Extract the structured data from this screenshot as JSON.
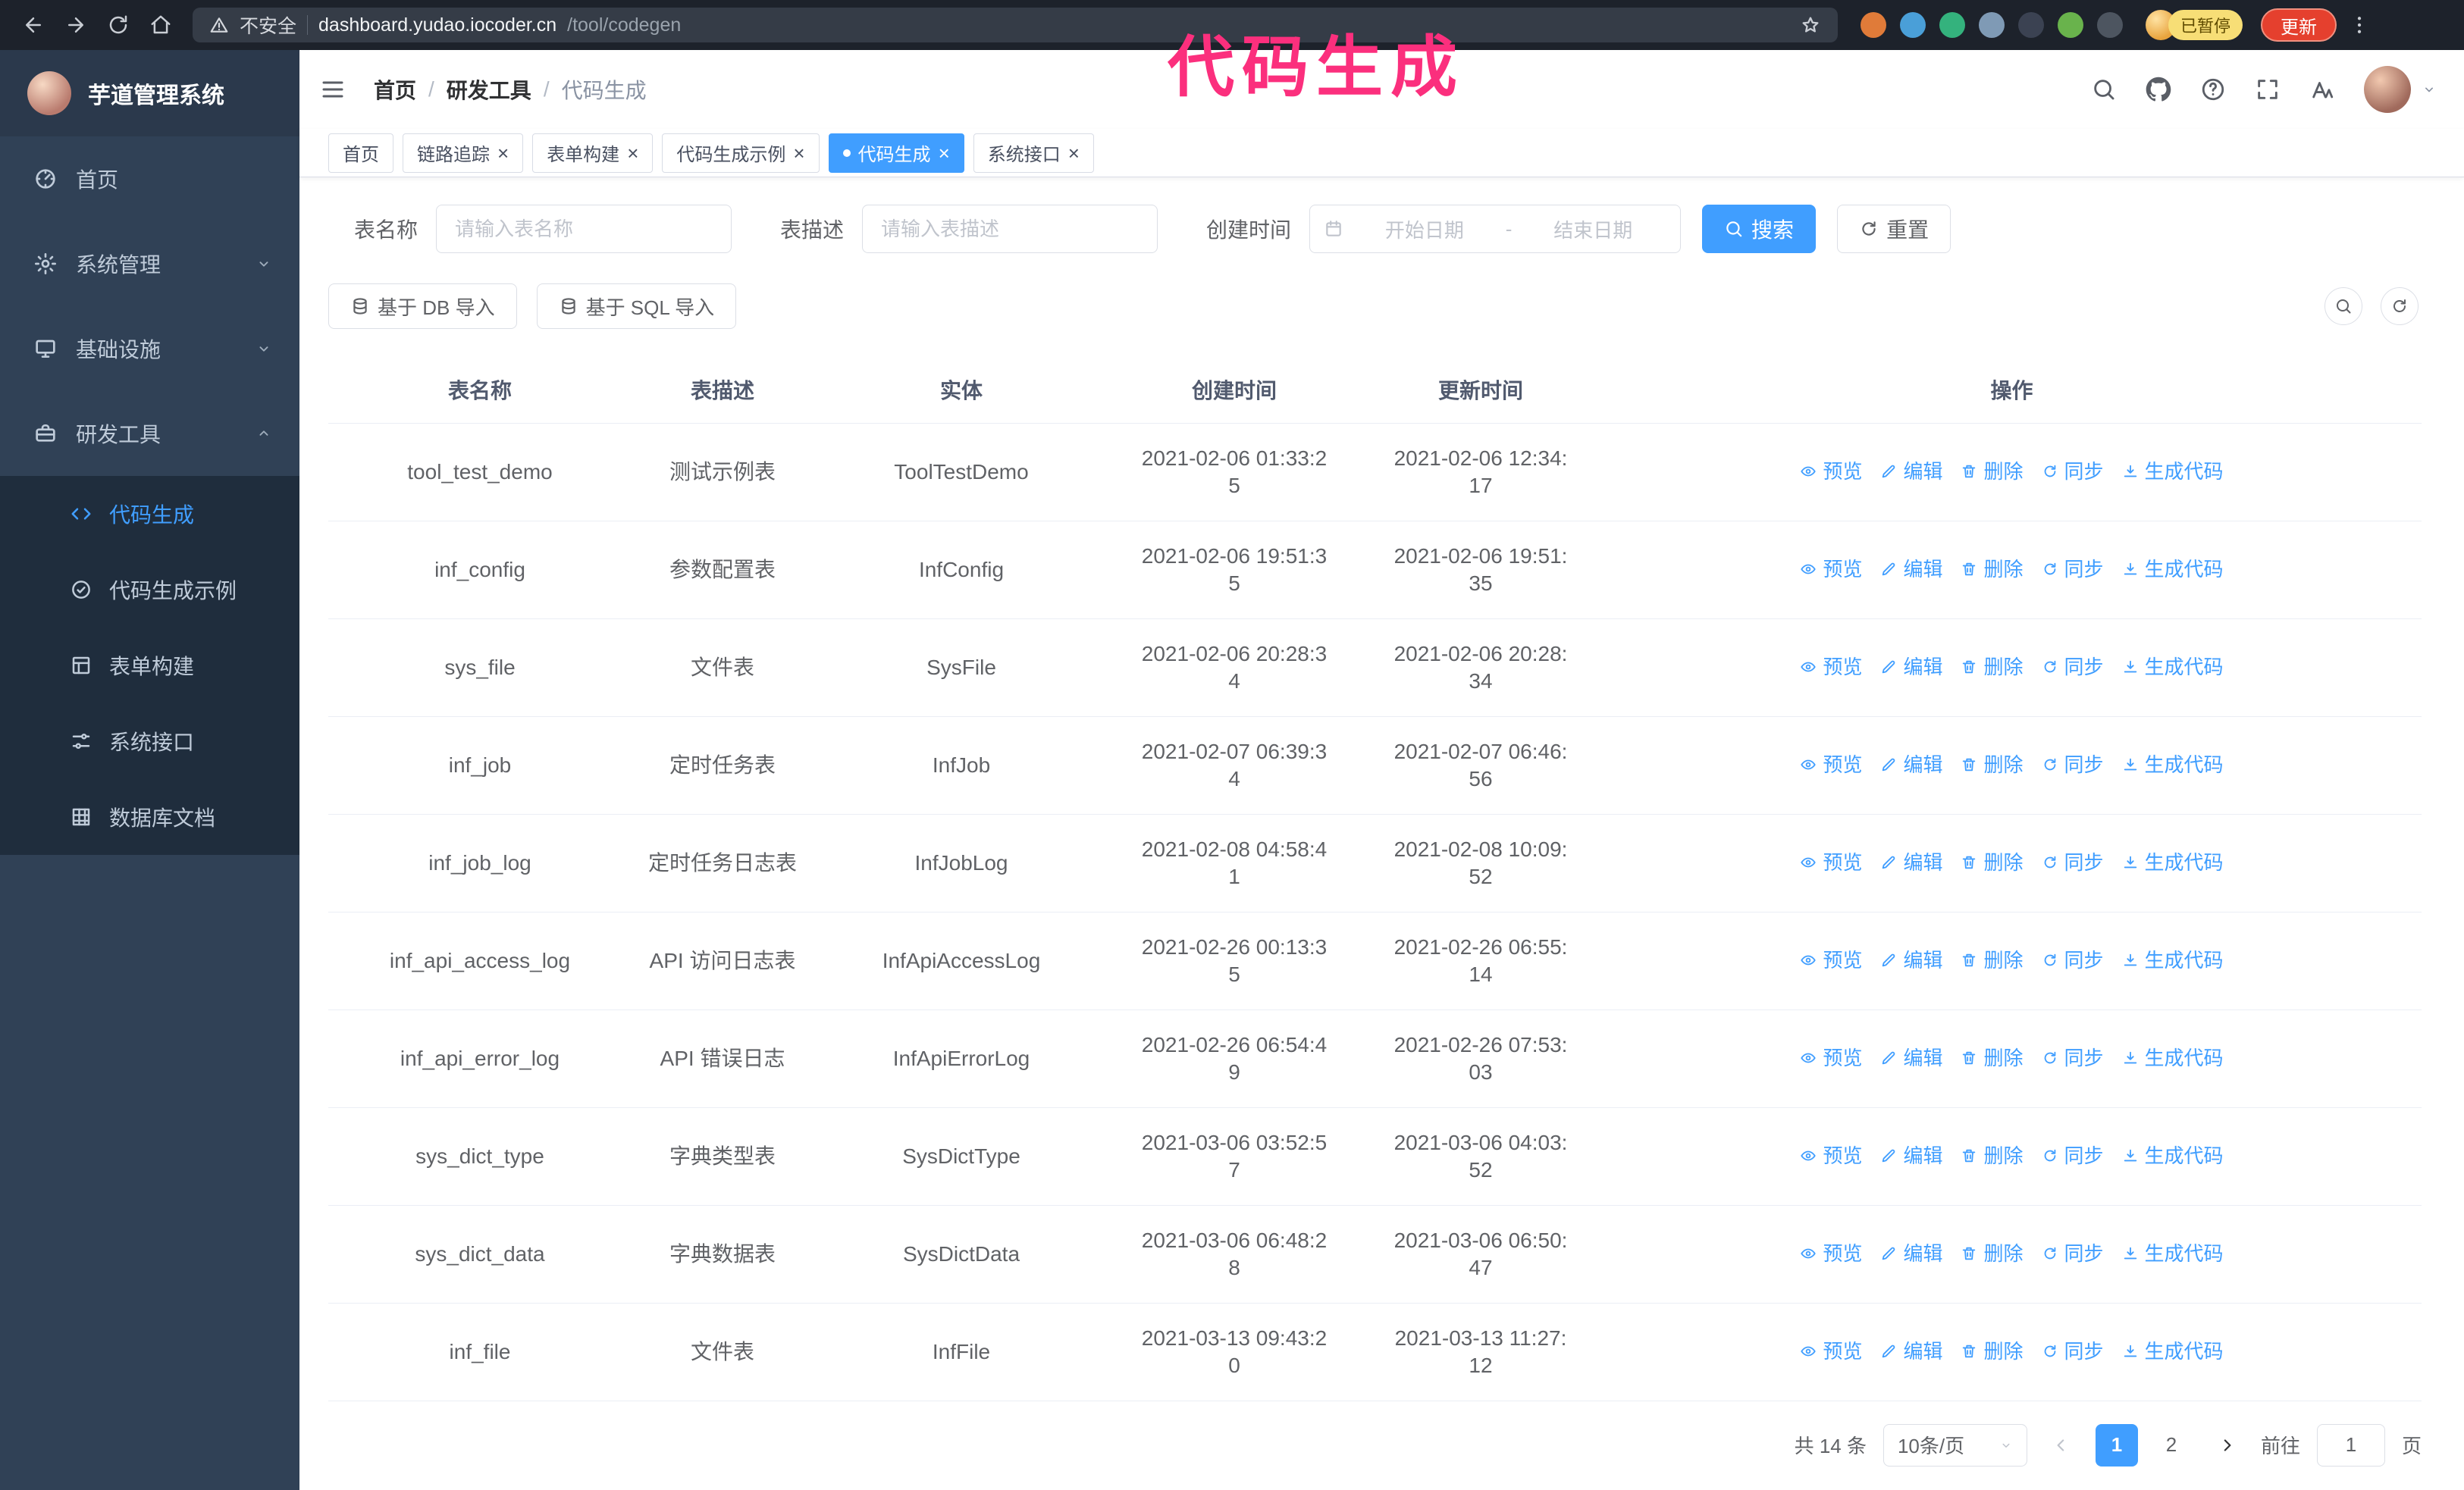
{
  "annotation": {
    "text": "代码生成"
  },
  "browser": {
    "security_label": "不安全",
    "url_host": "dashboard.yudao.iocoder.cn",
    "url_path": "/tool/codegen",
    "paused_badge": "已暂停",
    "update_button": "更新",
    "extension_colors": [
      "#e07b39",
      "#4a9fd8",
      "#34b27d",
      "#7f9ab5",
      "#3b4252",
      "#69b34c",
      "#4d5560"
    ]
  },
  "sidebar": {
    "app_title": "芋道管理系统",
    "items": [
      {
        "label": "首页",
        "icon": "dashboard-icon",
        "chevron": null,
        "expanded": false
      },
      {
        "label": "系统管理",
        "icon": "gear-icon",
        "chevron": "down",
        "expanded": false
      },
      {
        "label": "基础设施",
        "icon": "monitor-icon",
        "chevron": "down",
        "expanded": false
      },
      {
        "label": "研发工具",
        "icon": "briefcase-icon",
        "chevron": "up",
        "expanded": true
      }
    ],
    "subitems": [
      {
        "label": "代码生成",
        "icon": "code-icon",
        "active": true
      },
      {
        "label": "代码生成示例",
        "icon": "badge-icon",
        "active": false
      },
      {
        "label": "表单构建",
        "icon": "form-icon",
        "active": false
      },
      {
        "label": "系统接口",
        "icon": "sliders-icon",
        "active": false
      },
      {
        "label": "数据库文档",
        "icon": "grid-icon",
        "active": false
      }
    ]
  },
  "header": {
    "breadcrumb": [
      "首页",
      "研发工具",
      "代码生成"
    ],
    "separator": "/"
  },
  "tabs": [
    {
      "label": "首页",
      "closable": false,
      "active": false
    },
    {
      "label": "链路追踪",
      "closable": true,
      "active": false
    },
    {
      "label": "表单构建",
      "closable": true,
      "active": false
    },
    {
      "label": "代码生成示例",
      "closable": true,
      "active": false
    },
    {
      "label": "代码生成",
      "closable": true,
      "active": true
    },
    {
      "label": "系统接口",
      "closable": true,
      "active": false
    }
  ],
  "filters": {
    "table_name_label": "表名称",
    "table_name_placeholder": "请输入表名称",
    "table_desc_label": "表描述",
    "table_desc_placeholder": "请输入表描述",
    "create_time_label": "创建时间",
    "start_date_placeholder": "开始日期",
    "range_separator": "-",
    "end_date_placeholder": "结束日期",
    "search_button": "搜索",
    "reset_button": "重置"
  },
  "toolbar": {
    "import_db_label": "基于 DB 导入",
    "import_sql_label": "基于 SQL 导入"
  },
  "table": {
    "columns": [
      "表名称",
      "表描述",
      "实体",
      "创建时间",
      "更新时间",
      "操作"
    ],
    "action_labels": [
      "预览",
      "编辑",
      "删除",
      "同步",
      "生成代码"
    ],
    "action_icons": [
      "eye-icon",
      "edit-icon",
      "delete-icon",
      "sync-icon",
      "download-icon"
    ],
    "rows": [
      {
        "name": "tool_test_demo",
        "desc": "测试示例表",
        "entity": "ToolTestDemo",
        "created": "2021-02-06 01:33:25",
        "updated": "2021-02-06 12:34:17"
      },
      {
        "name": "inf_config",
        "desc": "参数配置表",
        "entity": "InfConfig",
        "created": "2021-02-06 19:51:35",
        "updated": "2021-02-06 19:51:35"
      },
      {
        "name": "sys_file",
        "desc": "文件表",
        "entity": "SysFile",
        "created": "2021-02-06 20:28:34",
        "updated": "2021-02-06 20:28:34"
      },
      {
        "name": "inf_job",
        "desc": "定时任务表",
        "entity": "InfJob",
        "created": "2021-02-07 06:39:34",
        "updated": "2021-02-07 06:46:56"
      },
      {
        "name": "inf_job_log",
        "desc": "定时任务日志表",
        "entity": "InfJobLog",
        "created": "2021-02-08 04:58:41",
        "updated": "2021-02-08 10:09:52"
      },
      {
        "name": "inf_api_access_log",
        "desc": "API 访问日志表",
        "entity": "InfApiAccessLog",
        "created": "2021-02-26 00:13:35",
        "updated": "2021-02-26 06:55:14"
      },
      {
        "name": "inf_api_error_log",
        "desc": "API 错误日志",
        "entity": "InfApiErrorLog",
        "created": "2021-02-26 06:54:49",
        "updated": "2021-02-26 07:53:03"
      },
      {
        "name": "sys_dict_type",
        "desc": "字典类型表",
        "entity": "SysDictType",
        "created": "2021-03-06 03:52:57",
        "updated": "2021-03-06 04:03:52"
      },
      {
        "name": "sys_dict_data",
        "desc": "字典数据表",
        "entity": "SysDictData",
        "created": "2021-03-06 06:48:28",
        "updated": "2021-03-06 06:50:47"
      },
      {
        "name": "inf_file",
        "desc": "文件表",
        "entity": "InfFile",
        "created": "2021-03-13 09:43:20",
        "updated": "2021-03-13 11:27:12"
      }
    ]
  },
  "pagination": {
    "total_label": "共 14 条",
    "page_size_label": "10条/页",
    "pages": [
      "1",
      "2"
    ],
    "active_page": "1",
    "goto_label": "前往",
    "goto_value": "1",
    "goto_unit": "页"
  },
  "colors": {
    "accent": "#409eff",
    "sidebar_bg": "#304156",
    "submenu_bg": "#1f2d3d",
    "annotation_pink": "#fb2f7d"
  }
}
